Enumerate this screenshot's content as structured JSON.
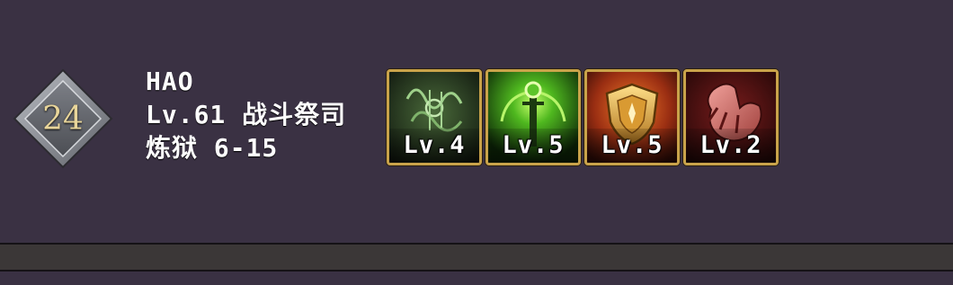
{
  "rank": {
    "number": "24",
    "icon": "diamond-rank-badge"
  },
  "player": {
    "name": "HAO",
    "level_class": "Lv.61 战斗祭司",
    "stage": "炼狱 6-15"
  },
  "skills": [
    {
      "icon": "green-rune-icon",
      "level": "Lv.4"
    },
    {
      "icon": "green-staff-icon",
      "level": "Lv.5"
    },
    {
      "icon": "golden-shield-icon",
      "level": "Lv.5"
    },
    {
      "icon": "red-claw-icon",
      "level": "Lv.2"
    }
  ],
  "colors": {
    "background": "#3a3143",
    "card_border": "#c9a34a",
    "rank_text": "#e8d59a"
  }
}
